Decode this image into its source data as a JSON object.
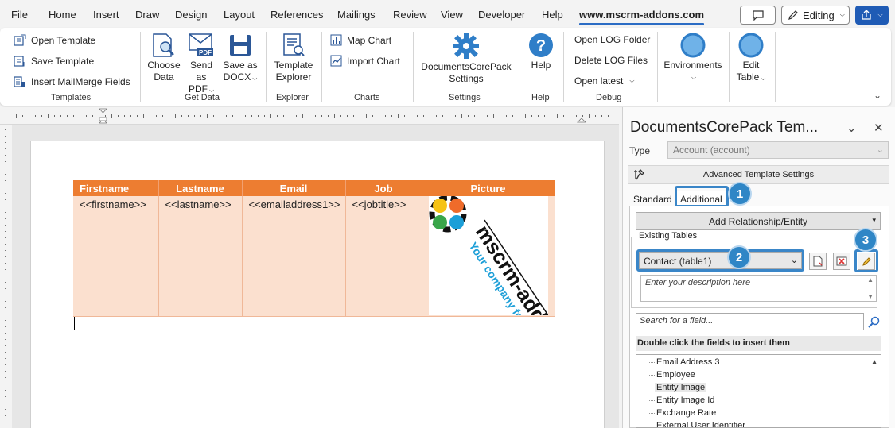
{
  "menu": {
    "items": [
      "File",
      "Home",
      "Insert",
      "Draw",
      "Design",
      "Layout",
      "References",
      "Mailings",
      "Review",
      "View",
      "Developer",
      "Help",
      "www.mscrm-addons.com"
    ],
    "active_index": 12,
    "editing_label": "Editing"
  },
  "ribbon": {
    "templates": {
      "open_template": "Open Template",
      "save_template": "Save Template",
      "insert_mailmerge": "Insert MailMerge Fields",
      "label": "Templates"
    },
    "get_data": {
      "choose_data_1": "Choose",
      "choose_data_2": "Data",
      "send_pdf_1": "Send as",
      "send_pdf_2": "PDF",
      "save_docx_1": "Save as",
      "save_docx_2": "DOCX",
      "label": "Get Data"
    },
    "explorer": {
      "template_explorer_1": "Template",
      "template_explorer_2": "Explorer",
      "label": "Explorer"
    },
    "charts": {
      "map_chart": "Map Chart",
      "import_chart": "Import Chart",
      "label": "Charts"
    },
    "settings": {
      "dcp_settings_1": "DocumentsCorePack",
      "dcp_settings_2": "Settings",
      "label": "Settings"
    },
    "help": {
      "help_btn": "Help",
      "label": "Help"
    },
    "debug": {
      "open_log": "Open LOG Folder",
      "delete_log": "Delete LOG Files",
      "open_latest": "Open latest",
      "label": "Debug"
    },
    "environments": "Environments",
    "edit_table_1": "Edit",
    "edit_table_2": "Table"
  },
  "document": {
    "table": {
      "headers": [
        "Firstname",
        "Lastname",
        "Email",
        "Job",
        "Picture"
      ],
      "cells": [
        "<<firstname>>",
        "<<lastname>>",
        "<<emailaddress1>>",
        "<<jobtitle>>"
      ]
    },
    "logo": {
      "brand": "mscrm-addons",
      "tagline": "Your company for"
    }
  },
  "panel": {
    "title": "DocumentsCorePack Tem...",
    "type_label": "Type",
    "type_value": "Account (account)",
    "advanced_settings": "Advanced Template Settings",
    "tabs": [
      "Standard",
      "Additional"
    ],
    "active_tab_index": 1,
    "add_relationship": "Add Relationship/Entity",
    "existing_tables_label": "Existing  Tables",
    "existing_table_value": "Contact (table1)",
    "description_placeholder": "Enter your description here",
    "search_placeholder": "Search for a field...",
    "fields_header": "Double click the fields to insert them",
    "fields": [
      "Email Address 3",
      "Employee",
      "Entity Image",
      "Entity Image Id",
      "Exchange Rate",
      "External User Identifier"
    ],
    "selected_field_index": 2,
    "callouts": [
      "1",
      "2",
      "3"
    ]
  },
  "colors": {
    "table_header": "#ed7d31",
    "table_body": "#fbe0cf",
    "accent_blue": "#2b6cc4",
    "callout_blue": "#2f86c6"
  }
}
